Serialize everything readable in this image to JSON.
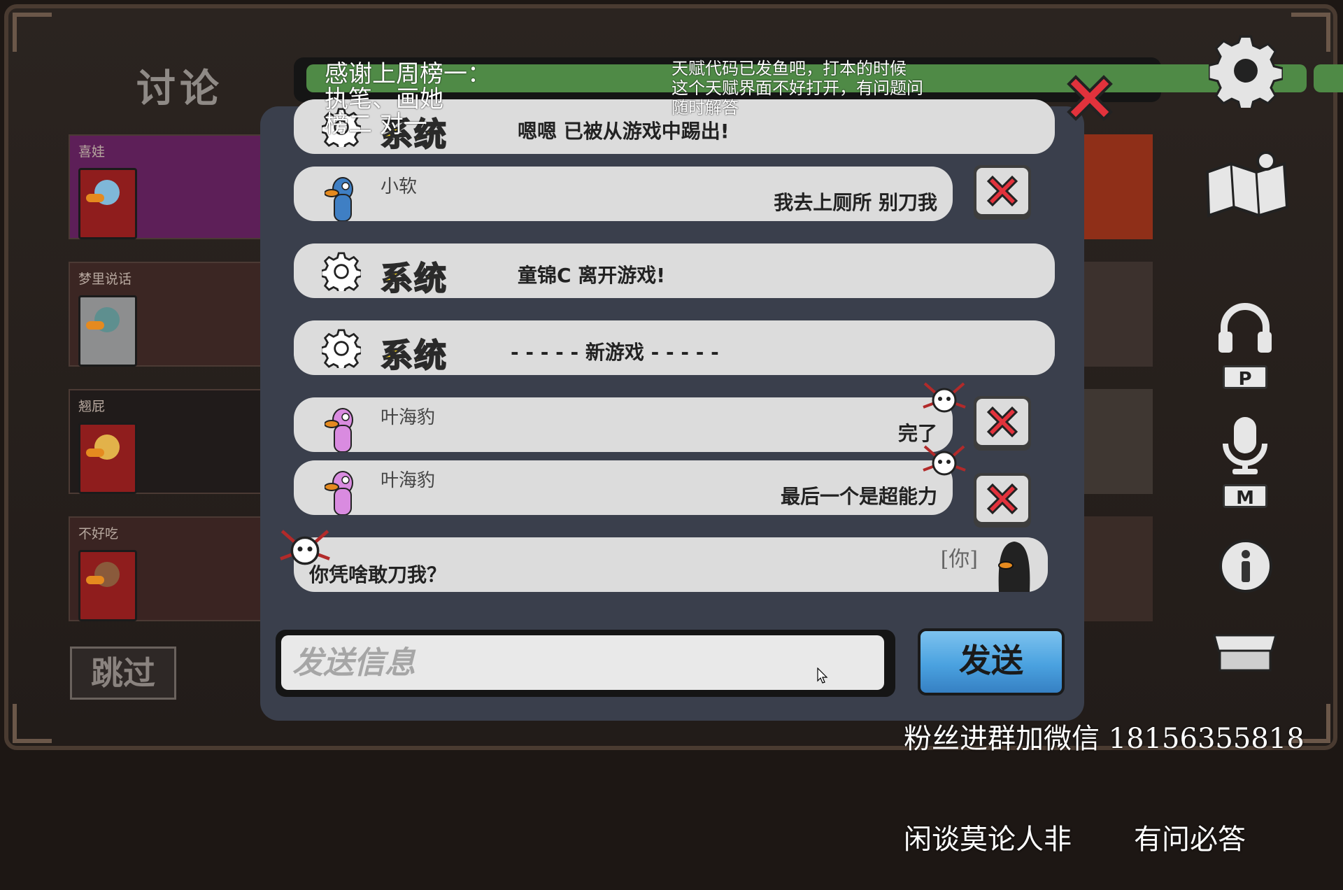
{
  "header": {
    "discuss_title": "讨论"
  },
  "players": [
    {
      "name": "喜娃"
    },
    {
      "name": "梦里说话"
    },
    {
      "name": "翘屁"
    },
    {
      "name": "不好吃"
    }
  ],
  "skip_label": "跳过",
  "chat": {
    "messages": [
      {
        "type": "system",
        "label": "系统",
        "text": "嗯嗯 已被从游戏中踢出!"
      },
      {
        "type": "user",
        "name": "小软",
        "text": "我去上厕所  别刀我",
        "avatar_color": "#3f7fc4"
      },
      {
        "type": "system",
        "label": "系统",
        "text": "童锦C 离开游戏!"
      },
      {
        "type": "system",
        "label": "系统",
        "text": "- - - - - 新游戏 - - - - -"
      },
      {
        "type": "user",
        "name": "叶海豹",
        "text": "完了",
        "avatar_color": "#d98be0"
      },
      {
        "type": "user",
        "name": "叶海豹",
        "text": "最后一个是超能力",
        "avatar_color": "#d98be0"
      },
      {
        "type": "self",
        "tag": "[你]",
        "text": "你凭啥敢刀我？"
      }
    ],
    "input_placeholder": "发送信息",
    "send_label": "发送"
  },
  "right_keys": {
    "push_to_talk": "P",
    "mic": "M"
  },
  "overlays": {
    "top_left": [
      "感谢上周榜一：",
      "执笔、画她",
      "榜二 对一"
    ],
    "top_right": [
      "天赋代码已发鱼吧，打本的时候",
      "这个天赋界面不好打开，有问题问",
      "随时解答"
    ],
    "bottom_right": [
      "粉丝进群加微信 18156355818",
      "闲谈莫论人非       有问必答"
    ]
  },
  "colors": {
    "system_label": "#f4d21e",
    "kill_red": "#e2323c",
    "timer_green": "#4f8a46",
    "send_blue": "#4aa2e0"
  }
}
